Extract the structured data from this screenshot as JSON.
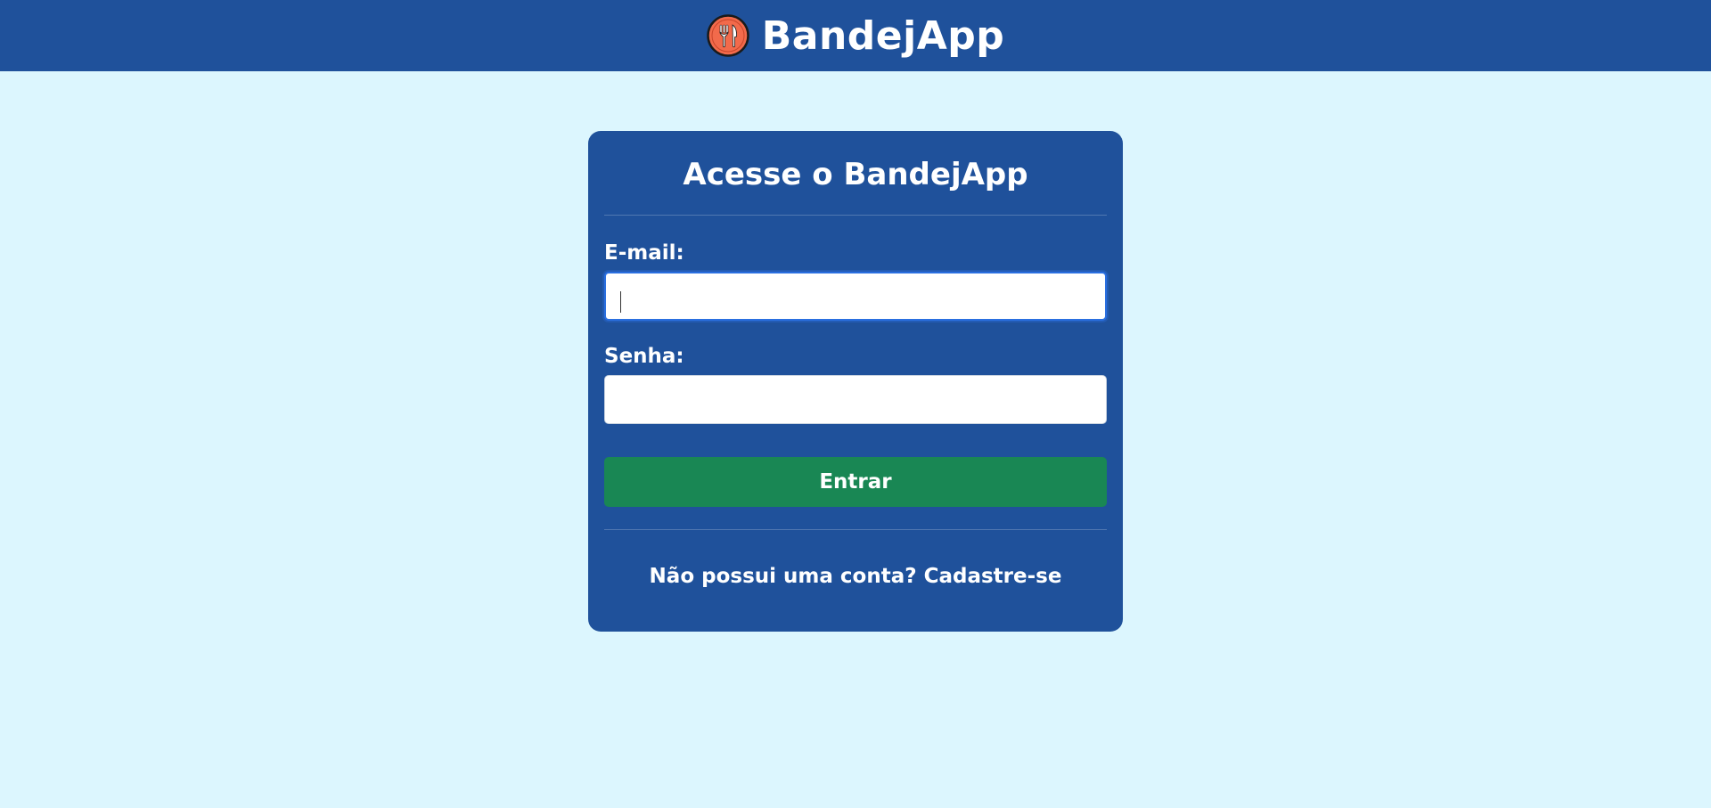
{
  "header": {
    "app_name": "BandejApp",
    "logo_icon": "fork-knife-icon"
  },
  "login_card": {
    "title": "Acesse o BandejApp",
    "email": {
      "label": "E-mail:",
      "value": "",
      "placeholder": ""
    },
    "password": {
      "label": "Senha:",
      "value": "",
      "placeholder": ""
    },
    "submit_label": "Entrar",
    "signup_prompt": "Não possui uma conta?",
    "signup_link": "Cadastre-se"
  },
  "colors": {
    "header_bg": "#1f519b",
    "page_bg": "#dcf6fe",
    "card_bg": "#1f519b",
    "button_bg": "#198754",
    "logo_bg": "#f26a4b"
  }
}
